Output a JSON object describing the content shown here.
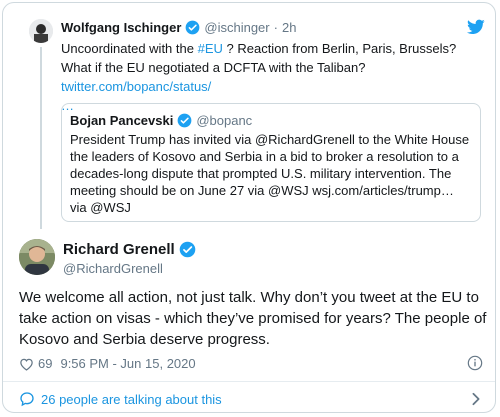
{
  "parent": {
    "name": "Wolfgang Ischinger",
    "handle": "@ischinger",
    "separator": "·",
    "time": "2h",
    "text_before": "Uncoordinated with the ",
    "hashtag": "#EU",
    "text_after": " ? Reaction from Berlin, Paris, Brussels? What if  the EU negotiated  a DCFTA with the Taliban? ",
    "link": "twitter.com/bopanc/status/",
    "ellipsis": "…"
  },
  "quote": {
    "name": "Bojan Pancevski",
    "handle": "@bopanc",
    "text": "President Trump has invited via @RichardGrenell to the White House the leaders of Kosovo and Serbia in a bid to broker a resolution to a decades-long dispute that prompted U.S. military intervention. The meeting should be on June 27 via @WSJ  wsj.com/articles/trump… via @WSJ"
  },
  "main": {
    "name": "Richard Grenell",
    "handle": "@RichardGrenell",
    "text": "We welcome all action, not just talk. Why don’t you tweet at the EU to take action on visas - which they’ve promised for years? The people of Kosovo and Serbia deserve progress.",
    "likes": "69",
    "timestamp": "9:56 PM - Jun 15, 2020"
  },
  "footer": {
    "talking": "26 people are talking about this"
  },
  "icons": {
    "verified": "verified-badge-icon",
    "twitter": "twitter-bird-icon",
    "heart": "heart-icon",
    "info": "info-icon",
    "comment": "comment-bubble-icon",
    "chevron": "chevron-right-icon"
  },
  "colors": {
    "accent": "#1da1f2",
    "link": "#1b95e0",
    "muted": "#657786",
    "border": "#cfd9de"
  }
}
